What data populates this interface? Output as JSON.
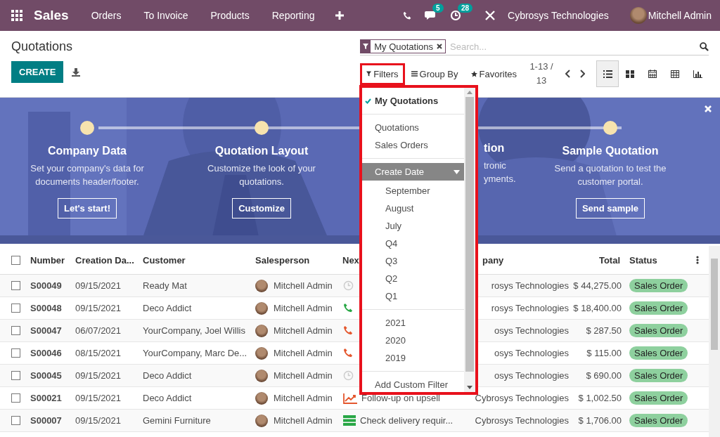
{
  "navbar": {
    "app": "Sales",
    "menu": [
      "Orders",
      "To Invoice",
      "Products",
      "Reporting"
    ],
    "chat_badge": "5",
    "activity_badge": "28",
    "company": "Cybrosys Technologies",
    "user": "Mitchell Admin"
  },
  "control_panel": {
    "title": "Quotations",
    "create": "CREATE",
    "facet": "My Quotations",
    "search_placeholder": "Search...",
    "filters": "Filters",
    "group_by": "Group By",
    "favorites": "Favorites",
    "pager": "1-13 / 13",
    "views": [
      {
        "kind": "list",
        "selected": true
      },
      {
        "kind": "kanban",
        "selected": false
      },
      {
        "kind": "calendar",
        "selected": false
      },
      {
        "kind": "pivot",
        "selected": false
      },
      {
        "kind": "graph",
        "selected": false
      }
    ]
  },
  "banner": {
    "steps": [
      {
        "kind": "full",
        "title": "Company Data",
        "lines": [
          "Set your company's data for",
          "documents header/footer."
        ],
        "button": "Let's start!"
      },
      {
        "kind": "full",
        "title": "Quotation Layout",
        "lines": [
          "Customize the look of your",
          "quotations."
        ],
        "button": "Customize"
      },
      {
        "kind": "partial",
        "title": "tion",
        "lines": [
          "tronic",
          "yments."
        ]
      },
      {
        "kind": "full",
        "title": "Sample Quotation",
        "lines": [
          "Send a quotation to test the",
          "customer portal."
        ],
        "button": "Send sample"
      }
    ]
  },
  "table": {
    "all_checked": false,
    "columns": [
      "Number",
      "Creation Da...",
      "Customer",
      "Salesperson",
      "Nex",
      "pany",
      "Total",
      "Status"
    ],
    "rows": [
      {
        "checked": false,
        "number": "S00049",
        "date": "09/15/2021",
        "customer": "Ready Mat",
        "salesperson": "Mitchell Admin",
        "activity": {
          "kind": "clock",
          "color": "#cccccc"
        },
        "company": "rosys Technologies",
        "total": "$ 44,275.00",
        "status": "Sales Order"
      },
      {
        "checked": false,
        "number": "S00048",
        "date": "09/15/2021",
        "customer": "Deco Addict",
        "salesperson": "Mitchell Admin",
        "activity": {
          "kind": "phone",
          "color": "#28a745"
        },
        "company": "rosys Technologies",
        "total": "$ 18,400.00",
        "status": "Sales Order"
      },
      {
        "checked": false,
        "number": "S00047",
        "date": "06/07/2021",
        "customer": "YourCompany, Joel Willis",
        "salesperson": "Mitchell Admin",
        "activity": {
          "kind": "phone",
          "color": "#e4572e"
        },
        "company": "osys Technologies",
        "total": "$ 287.50",
        "status": "Sales Order"
      },
      {
        "checked": false,
        "number": "S00046",
        "date": "08/15/2021",
        "customer": "YourCompany, Marc De...",
        "salesperson": "Mitchell Admin",
        "activity": {
          "kind": "phone",
          "color": "#e4572e"
        },
        "company": "osys Technologies",
        "total": "$ 115.00",
        "status": "Sales Order"
      },
      {
        "checked": false,
        "number": "S00045",
        "date": "09/15/2021",
        "customer": "Deco Addict",
        "salesperson": "Mitchell Admin",
        "activity": {
          "kind": "clock",
          "color": "#cccccc"
        },
        "company": "osys Technologies",
        "total": "$ 690.00",
        "status": "Sales Order"
      },
      {
        "checked": false,
        "number": "S00021",
        "date": "09/15/2021",
        "customer": "Deco Addict",
        "salesperson": "Mitchell Admin",
        "activity": {
          "kind": "chart",
          "color": "#e4572e",
          "summary": "Follow-up on upsell"
        },
        "company": "Cybrosys Technologies",
        "total": "$ 1,002.50",
        "status": "Sales Order"
      },
      {
        "checked": false,
        "number": "S00007",
        "date": "09/15/2021",
        "customer": "Gemini Furniture",
        "salesperson": "Mitchell Admin",
        "activity": {
          "kind": "todo",
          "color": "#28a745",
          "summary": "Check delivery requir..."
        },
        "company": "Cybrosys Technologies",
        "total": "$ 1,706.00",
        "status": "Sales Order"
      }
    ]
  },
  "filter_menu": {
    "groups": [
      {
        "kind": "options",
        "items": [
          {
            "label": "My Quotations",
            "checked": true
          }
        ]
      },
      {
        "kind": "options",
        "items": [
          {
            "label": "Quotations",
            "checked": false
          },
          {
            "label": "Sales Orders",
            "checked": false
          }
        ]
      },
      {
        "kind": "date",
        "label": "Create Date",
        "expanded": true,
        "sections": [
          {
            "items": [
              {
                "label": "September",
                "checked": false
              },
              {
                "label": "August",
                "checked": false
              },
              {
                "label": "July",
                "checked": false
              },
              {
                "label": "Q4",
                "checked": false
              },
              {
                "label": "Q3",
                "checked": false
              },
              {
                "label": "Q2",
                "checked": false
              },
              {
                "label": "Q1",
                "checked": false
              }
            ]
          },
          {
            "items": [
              {
                "label": "2021",
                "checked": false
              },
              {
                "label": "2020",
                "checked": false
              },
              {
                "label": "2019",
                "checked": false
              }
            ]
          }
        ]
      },
      {
        "kind": "custom",
        "label": "Add Custom Filter"
      }
    ]
  }
}
